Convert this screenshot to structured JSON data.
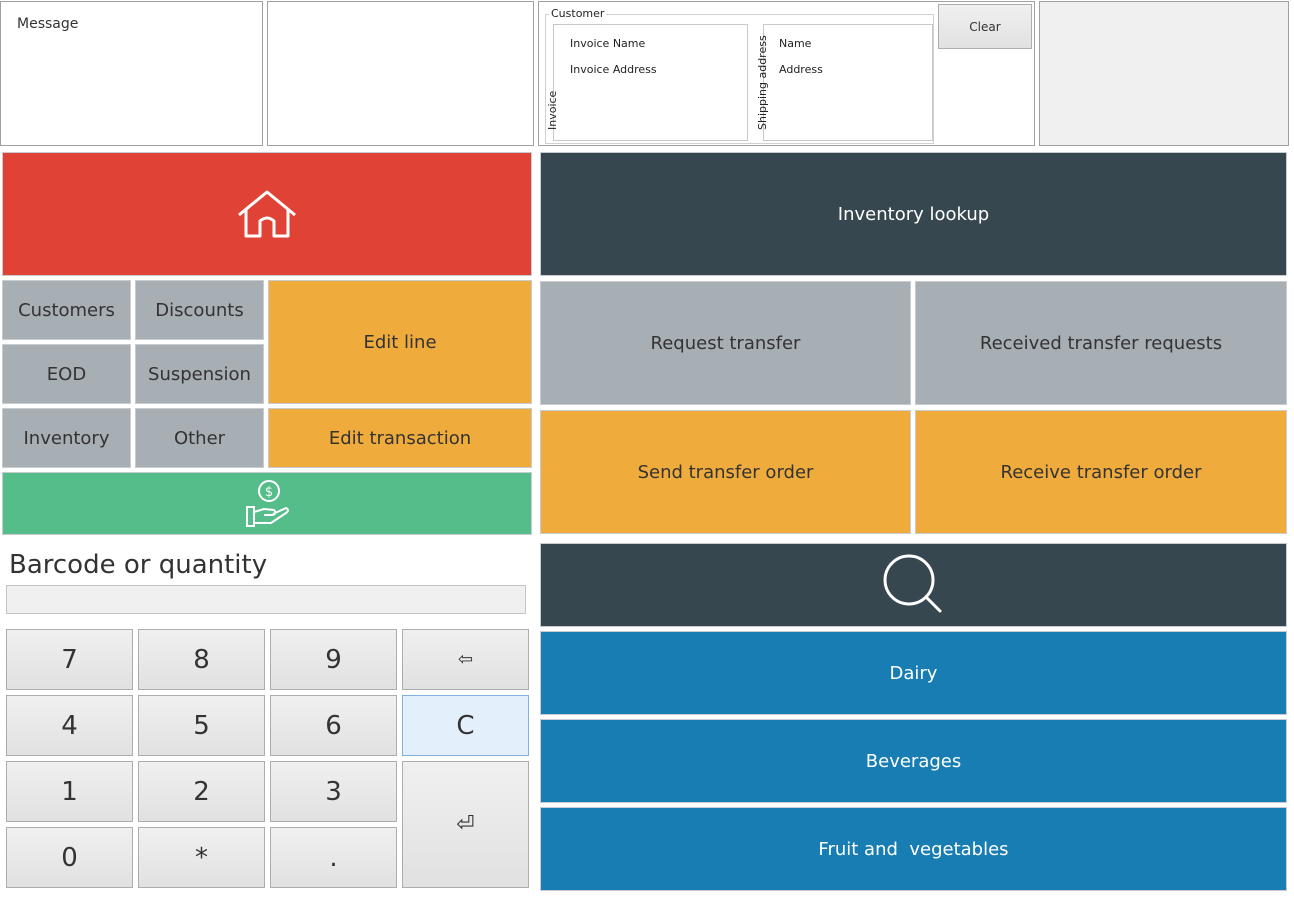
{
  "top": {
    "message_label": "Message",
    "customer": {
      "group_label": "Customer",
      "invoice_tab": "Invoice",
      "shipping_tab": "Shipping address",
      "invoice_name": "Invoice Name",
      "invoice_address": "Invoice Address",
      "ship_name": "Name",
      "ship_address": "Address"
    },
    "clear_button": "Clear"
  },
  "left": {
    "home_icon": "home-icon",
    "buttons": {
      "customers": "Customers",
      "discounts": "Discounts",
      "edit_line": "Edit line",
      "eod": "EOD",
      "suspension": "Suspension",
      "inventory": "Inventory",
      "other": "Other",
      "edit_transaction": "Edit transaction"
    },
    "pay_icon": "payment-hand-icon"
  },
  "right": {
    "inventory_lookup": "Inventory lookup",
    "request_transfer": "Request transfer",
    "received_transfer_requests": "Received transfer requests",
    "send_transfer_order": "Send transfer order",
    "receive_transfer_order": "Receive transfer order",
    "search_icon": "search-icon",
    "categories": [
      "Dairy",
      "Beverages",
      "Fruit and  vegetables"
    ]
  },
  "numpad": {
    "label": "Barcode or quantity",
    "input_value": "",
    "keys": {
      "k7": "7",
      "k8": "8",
      "k9": "9",
      "k4": "4",
      "k5": "5",
      "k6": "6",
      "k1": "1",
      "k2": "2",
      "k3": "3",
      "k0": "0",
      "kstar": "*",
      "kdot": ".",
      "clear": "C",
      "backspace": "⇦",
      "enter": "⏎"
    }
  },
  "colors": {
    "red": "#e04336",
    "dark": "#37474f",
    "gray": "#a7aeb4",
    "orange": "#f0ab3d",
    "green": "#55bd8a",
    "blue": "#177db3"
  }
}
